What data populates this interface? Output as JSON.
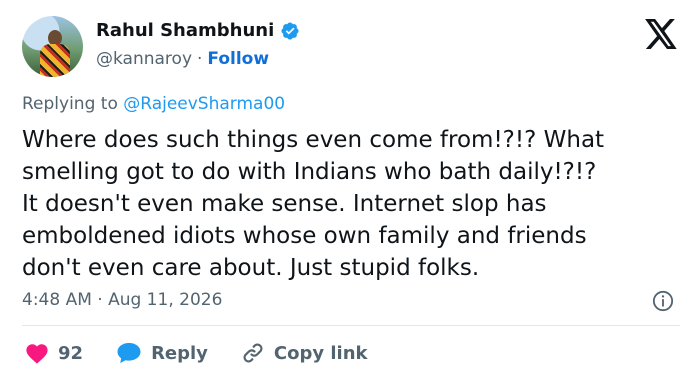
{
  "author": {
    "name": "Rahul Shambhuni",
    "handle": "@kannaroy",
    "separator": "·",
    "follow_label": "Follow",
    "verified_color": "#1d9bf0"
  },
  "reply_context": {
    "prefix": "Replying to",
    "mention": "@RajeevSharma00"
  },
  "tweet": {
    "text": "Where does such things even come from!?!? What\nsmelling got to do with Indians who bath daily!?!?\nIt doesn't even make sense. Internet slop has\nemboldened idiots whose own family and friends\ndon't even care about. Just stupid folks.",
    "timestamp": "4:48 AM · Aug 11, 2026"
  },
  "actions": {
    "like_count": "92",
    "reply_label": "Reply",
    "copy_link_label": "Copy link"
  },
  "icons": {
    "platform_logo": "x-logo-icon",
    "info": "info-icon",
    "like": "heart-icon",
    "reply": "speech-bubble-icon",
    "copy_link": "link-icon"
  },
  "colors": {
    "like": "#f91880",
    "reply": "#1d9bf0",
    "follow": "#0f6fd6",
    "muted": "#536471"
  }
}
